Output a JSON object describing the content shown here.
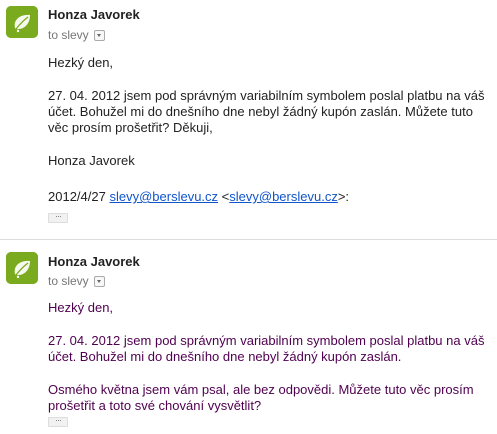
{
  "messages": [
    {
      "sender": "Honza Javorek",
      "recipient": "to slevy",
      "body": [
        "Hezký den,",
        "27. 04. 2012 jsem pod správným variabilním symbolem poslal platbu na váš účet. Bohužel mi do dnešního dne nebyl žádný kupón zaslán. Můžete tuto věc prosím prošetřit? Děkuji,",
        "Honza Javorek"
      ],
      "quote_header": {
        "date": "2012/4/27",
        "email_link": "slevy@berslevu.cz",
        "lt": "<",
        "email_link_2": "slevy@berslevu.cz",
        "gt": ">:"
      },
      "trim_label": "···"
    },
    {
      "sender": "Honza Javorek",
      "recipient": "to slevy",
      "body": [
        "Hezký den,",
        "27. 04. 2012 jsem pod správným variabilním symbolem poslal platbu na váš účet. Bohužel mi do dnešního dne nebyl žádný kupón zaslán.",
        "Osmého května jsem vám psal, ale bez odpovědi. Můžete tuto věc prosím prošetřit a toto své chování vysvětlit?"
      ],
      "trim_label": "···"
    }
  ],
  "colors": {
    "avatar_bg": "#7aab1e",
    "link": "#1155cc",
    "quoted_text": "#500050"
  },
  "icons": {
    "avatar": "leaf-avatar-icon",
    "recipient_menu": "chevron-down-icon"
  }
}
